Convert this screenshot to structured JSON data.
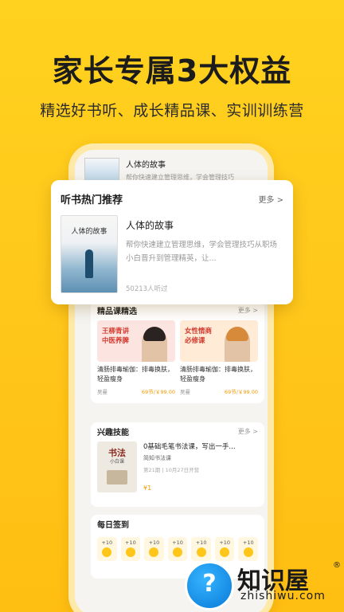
{
  "hero": {
    "headline": "家长专属3大权益",
    "subline": "精选好书听、成长精品课、实训训练营"
  },
  "mini_top": {
    "title": "人体的故事",
    "desc": "帮你快速建立管理思维，学会管理技巧"
  },
  "popup": {
    "title": "听书热门推荐",
    "more": "更多 >",
    "cover_text": "人体的故事",
    "book_title": "人体的故事",
    "desc": "帮你快速建立管理思维，学会管理技巧从职场小白晋升到管理精英，让...",
    "listens": "50213人听过"
  },
  "courses_section": {
    "title": "精品课精选",
    "more": "更多 >",
    "items": [
      {
        "tag": "王柳青讲 中医养脾",
        "name": "清肠排毒瑜伽：排毒换肤，轻盈瘦身",
        "author": "吴曼",
        "price": "69节/￥99.00",
        "color": "#FCE4E0",
        "hair": "#2b2322"
      },
      {
        "tag": "女性情商 必修课",
        "name": "清肠排毒瑜伽：排毒换肤，轻盈瘦身",
        "author": "吴曼",
        "price": "69节/￥99.00",
        "color": "#FFEBD6",
        "hair": "#d68a3a"
      }
    ]
  },
  "skills_section": {
    "title": "兴趣技能",
    "more": "更多 >",
    "cover_title": "书法",
    "cover_sub": "小白课",
    "item_title": "0基础毛笔书法课，写出一手...",
    "item_sub": "简知书法课",
    "item_info": "第21期 | 10月27日开营",
    "item_price": "¥1"
  },
  "checkin_section": {
    "title": "每日签到",
    "days": [
      "+10",
      "+10",
      "+10",
      "+10",
      "+10",
      "+10",
      "+10"
    ]
  },
  "watermark": {
    "brand": "知识屋",
    "reg": "®",
    "url": "zhishiwu.com",
    "q": "?"
  }
}
